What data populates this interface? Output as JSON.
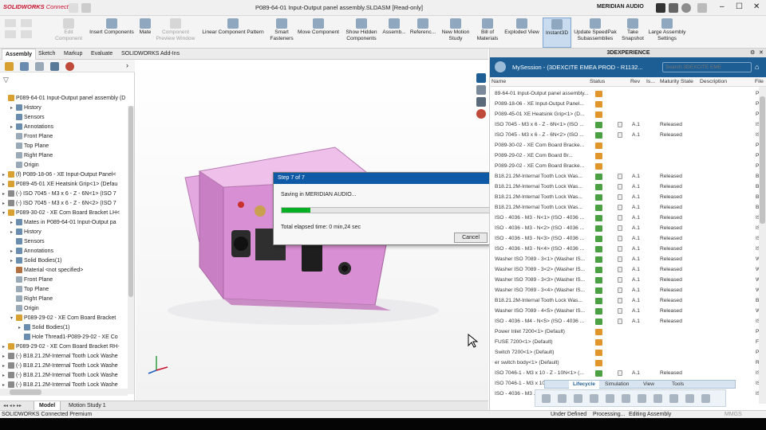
{
  "app": {
    "logo_main": "SOLIDWORKS",
    "logo_sub": "Connected"
  },
  "window": {
    "title": "P089-64-01 Input-Output panel assembly.SLDASM [Read-only]",
    "account": "MERIDIAN AUDIO"
  },
  "ribbon": [
    {
      "label": "Edit\nComponent",
      "disabled": true
    },
    {
      "label": "Insert Components",
      "disabled": false
    },
    {
      "label": "Mate",
      "disabled": false
    },
    {
      "label": "Component\nPreview Window",
      "disabled": true
    },
    {
      "label": "Linear Component Pattern",
      "disabled": false
    },
    {
      "label": "Smart\nFasteners",
      "disabled": false
    },
    {
      "label": "Move Component",
      "disabled": false
    },
    {
      "label": "Show Hidden\nComponents",
      "disabled": false
    },
    {
      "label": "Assemb...",
      "disabled": false
    },
    {
      "label": "Referenc...",
      "disabled": false
    },
    {
      "label": "New Motion\nStudy",
      "disabled": false
    },
    {
      "label": "Bill of\nMaterials",
      "disabled": false
    },
    {
      "label": "Exploded View",
      "disabled": false
    },
    {
      "label": "Instant3D",
      "disabled": false
    },
    {
      "label": "Update SpeedPak\nSubassemblies",
      "disabled": false
    },
    {
      "label": "Take\nSnapshot",
      "disabled": false
    },
    {
      "label": "Large Assembly\nSettings",
      "disabled": false
    }
  ],
  "tabs": [
    "Assembly",
    "Sketch",
    "Markup",
    "Evaluate",
    "SOLIDWORKS Add-Ins"
  ],
  "tree": [
    {
      "depth": 0,
      "exp": "",
      "label": "P089-64-01 Input-Output panel assembly (D",
      "icon": "#d8a030"
    },
    {
      "depth": 1,
      "exp": "▸",
      "label": "History",
      "icon": "#6a8caf"
    },
    {
      "depth": 1,
      "exp": "",
      "label": "Sensors",
      "icon": "#6a8caf"
    },
    {
      "depth": 1,
      "exp": "▸",
      "label": "Annotations",
      "icon": "#6a8caf"
    },
    {
      "depth": 1,
      "exp": "",
      "label": "Front Plane",
      "icon": "#9aa9b8"
    },
    {
      "depth": 1,
      "exp": "",
      "label": "Top Plane",
      "icon": "#9aa9b8"
    },
    {
      "depth": 1,
      "exp": "",
      "label": "Right Plane",
      "icon": "#9aa9b8"
    },
    {
      "depth": 1,
      "exp": "",
      "label": "Origin",
      "icon": "#9aa9b8"
    },
    {
      "depth": 0,
      "exp": "▸",
      "label": "(f) P089-18-06 - XE Input-Output Panel<",
      "icon": "#d8a030"
    },
    {
      "depth": 0,
      "exp": "▸",
      "label": "P089-45-01 XE Heatsink Grip<1> (Defau",
      "icon": "#d8a030"
    },
    {
      "depth": 0,
      "exp": "▸",
      "label": "(-) ISO 7045 - M3 x 6 - Z - 6N<1> (ISO 7",
      "icon": "#8a8a8a"
    },
    {
      "depth": 0,
      "exp": "▸",
      "label": "(-) ISO 7045 - M3 x 6 - Z - 6N<2> (ISO 7",
      "icon": "#8a8a8a"
    },
    {
      "depth": 0,
      "exp": "▾",
      "label": "P089-30-02 - XE Com Board Bracket LH<",
      "icon": "#d8a030"
    },
    {
      "depth": 1,
      "exp": "▸",
      "label": "Mates in P089-64-01 Input-Output pa",
      "icon": "#6a8caf"
    },
    {
      "depth": 1,
      "exp": "▸",
      "label": "History",
      "icon": "#6a8caf"
    },
    {
      "depth": 1,
      "exp": "",
      "label": "Sensors",
      "icon": "#6a8caf"
    },
    {
      "depth": 1,
      "exp": "▸",
      "label": "Annotations",
      "icon": "#6a8caf"
    },
    {
      "depth": 1,
      "exp": "▸",
      "label": "Solid Bodies(1)",
      "icon": "#6a8caf"
    },
    {
      "depth": 1,
      "exp": "",
      "label": "Material <not specified>",
      "icon": "#b07040"
    },
    {
      "depth": 1,
      "exp": "",
      "label": "Front Plane",
      "icon": "#9aa9b8"
    },
    {
      "depth": 1,
      "exp": "",
      "label": "Top Plane",
      "icon": "#9aa9b8"
    },
    {
      "depth": 1,
      "exp": "",
      "label": "Right Plane",
      "icon": "#9aa9b8"
    },
    {
      "depth": 1,
      "exp": "",
      "label": "Origin",
      "icon": "#9aa9b8"
    },
    {
      "depth": 1,
      "exp": "▾",
      "label": "P089-29-02 - XE Com Board Bracket",
      "icon": "#d8a030"
    },
    {
      "depth": 2,
      "exp": "▸",
      "label": "Solid Bodies(1)",
      "icon": "#6a8caf"
    },
    {
      "depth": 2,
      "exp": "",
      "label": "Hole Thread1-P089-29-02 - XE Co",
      "icon": "#6a8caf"
    },
    {
      "depth": 0,
      "exp": "▸",
      "label": "P089-29-02 - XE Com Board Bracket RH-",
      "icon": "#d8a030"
    },
    {
      "depth": 0,
      "exp": "▸",
      "label": "(-) B18.21.2M-Internal Tooth Lock Washe",
      "icon": "#8a8a8a"
    },
    {
      "depth": 0,
      "exp": "▸",
      "label": "(-) B18.21.2M-Internal Tooth Lock Washe",
      "icon": "#8a8a8a"
    },
    {
      "depth": 0,
      "exp": "▸",
      "label": "(-) B18.21.2M-Internal Tooth Lock Washe",
      "icon": "#8a8a8a"
    },
    {
      "depth": 0,
      "exp": "▸",
      "label": "(-) B18.21.2M-Internal Tooth Lock Washe",
      "icon": "#8a8a8a"
    }
  ],
  "bottom_tabs": [
    "Model",
    "Motion Study 1"
  ],
  "dialog": {
    "title": "Step 7 of 7",
    "message": "Saving in MERIDIAN AUDIO...",
    "progress": 0.14,
    "elapsed": "Total elapsed time: 0 min,24 sec",
    "cancel": "Cancel"
  },
  "status": {
    "left": "SOLIDWORKS Connected Premium",
    "s1": "Under Defined",
    "s2": "Processing...",
    "s3": "Editing Assembly",
    "s4": "MMGS"
  },
  "dx": {
    "header": "3DEXPERIENCE",
    "session": "MySession - (3DEXCITE EMEA PROD - R1132...",
    "search_placeholder": "Search 3DEXCITE EME",
    "columns": [
      "Name",
      "Status",
      "Rev",
      "Is...",
      "Maturity State",
      "Description",
      "File"
    ],
    "status_colors": {
      "new": "#e0962a",
      "saved": "#4aa042"
    },
    "rows": [
      {
        "name": "89-64-01 Input-Output panel assembly...",
        "status": "new",
        "rev": "",
        "maturity": "",
        "file": "P"
      },
      {
        "name": "P089-18-06 - XE Input-Output Panel...",
        "status": "new",
        "rev": "",
        "maturity": "",
        "file": "P"
      },
      {
        "name": "P089-45-01 XE Heatsink Grip<1> (D...",
        "status": "new",
        "rev": "",
        "maturity": "",
        "file": "P"
      },
      {
        "name": "ISO 7045 - M3 x 6 - Z - 6N<1> (ISO ...",
        "status": "saved",
        "rev": "A.1",
        "maturity": "Released",
        "file": "IS"
      },
      {
        "name": "ISO 7045 - M3 x 6 - Z - 6N<2> (ISO ...",
        "status": "saved",
        "rev": "A.1",
        "maturity": "Released",
        "file": "IS"
      },
      {
        "name": "P089-30-02 - XE Com Board Bracke...",
        "status": "new",
        "rev": "",
        "maturity": "",
        "file": "P"
      },
      {
        "name": "P089-29-02 - XE Com Board Br...",
        "status": "new",
        "rev": "",
        "maturity": "",
        "file": "P"
      },
      {
        "name": "P089-29-02 - XE Com Board Bracke...",
        "status": "new",
        "rev": "",
        "maturity": "",
        "file": "P"
      },
      {
        "name": "B18.21.2M-Internal Tooth Lock Was...",
        "status": "saved",
        "rev": "A.1",
        "maturity": "Released",
        "file": "B"
      },
      {
        "name": "B18.21.2M-Internal Tooth Lock Was...",
        "status": "saved",
        "rev": "A.1",
        "maturity": "Released",
        "file": "B"
      },
      {
        "name": "B18.21.2M-Internal Tooth Lock Was...",
        "status": "saved",
        "rev": "A.1",
        "maturity": "Released",
        "file": "B"
      },
      {
        "name": "B18.21.2M-Internal Tooth Lock Was...",
        "status": "saved",
        "rev": "A.1",
        "maturity": "Released",
        "file": "B"
      },
      {
        "name": "ISO - 4036 - M3 - N<1> (ISO - 4036 ...",
        "status": "saved",
        "rev": "A.1",
        "maturity": "Released",
        "file": "IS"
      },
      {
        "name": "ISO - 4036 - M3 - N<2> (ISO - 4036 ...",
        "status": "saved",
        "rev": "A.1",
        "maturity": "Released",
        "file": "IS"
      },
      {
        "name": "ISO - 4036 - M3 - N<3> (ISO - 4036 ...",
        "status": "saved",
        "rev": "A.1",
        "maturity": "Released",
        "file": "IS"
      },
      {
        "name": "ISO - 4036 - M3 - N<4> (ISO - 4036 ...",
        "status": "saved",
        "rev": "A.1",
        "maturity": "Released",
        "file": "IS"
      },
      {
        "name": "Washer ISO 7089 - 3<1> (Washer IS...",
        "status": "saved",
        "rev": "A.1",
        "maturity": "Released",
        "file": "W"
      },
      {
        "name": "Washer ISO 7089 - 3<2> (Washer IS...",
        "status": "saved",
        "rev": "A.1",
        "maturity": "Released",
        "file": "W"
      },
      {
        "name": "Washer ISO 7089 - 3<3> (Washer IS...",
        "status": "saved",
        "rev": "A.1",
        "maturity": "Released",
        "file": "W"
      },
      {
        "name": "Washer ISO 7089 - 3<4> (Washer IS...",
        "status": "saved",
        "rev": "A.1",
        "maturity": "Released",
        "file": "W"
      },
      {
        "name": "B18.21.2M-Internal Tooth Lock Was...",
        "status": "saved",
        "rev": "A.1",
        "maturity": "Released",
        "file": "B"
      },
      {
        "name": "Washer ISO 7089 - 4<5> (Washer IS...",
        "status": "saved",
        "rev": "A.1",
        "maturity": "Released",
        "file": "W"
      },
      {
        "name": "ISO - 4036 - M4 - N<5> (ISO - 4036 ...",
        "status": "saved",
        "rev": "A.1",
        "maturity": "Released",
        "file": "IS"
      },
      {
        "name": "Power Inlet 7200<1> (Default)",
        "status": "new",
        "rev": "",
        "maturity": "",
        "file": "P"
      },
      {
        "name": "FUSE 7200<1> (Default)",
        "status": "new",
        "rev": "",
        "maturity": "",
        "file": "F"
      },
      {
        "name": "Switch 7200<1> (Default)",
        "status": "new",
        "rev": "",
        "maturity": "",
        "file": "P"
      },
      {
        "name": "er switch body<1> (Default)",
        "status": "new",
        "rev": "",
        "maturity": "",
        "file": "R"
      },
      {
        "name": "ISO 7046-1 - M3 x 10 - Z - 10N<1> (...",
        "status": "saved",
        "rev": "A.1",
        "maturity": "Released",
        "file": "IS"
      },
      {
        "name": "ISO 7046-1 - M3 x 10 - Z - 10N...",
        "status": "saved",
        "rev": "A.1",
        "maturity": "Released",
        "file": "IS"
      },
      {
        "name": "ISO - 4036 - M3 ...",
        "status": "saved",
        "rev": "A.1",
        "maturity": "Released",
        "file": "IS"
      }
    ],
    "tools_tabs": [
      "Lifecycle",
      "Simulation",
      "View",
      "Tools"
    ]
  }
}
